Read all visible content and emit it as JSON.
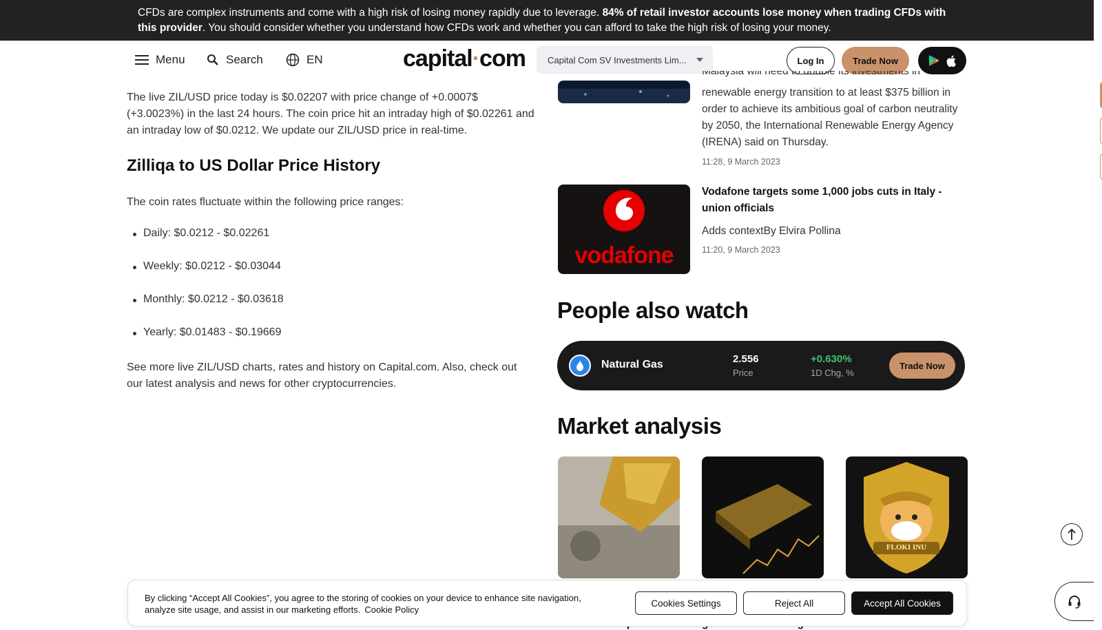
{
  "risk_banner": {
    "text_plain": "CFDs are complex instruments and come with a high risk of losing money rapidly due to leverage. ",
    "text_bold": "84% of retail investor accounts lose money when trading CFDs with this provider",
    "text_rest": ". You should consider whether you understand how CFDs work and whether you can afford to take the high risk of losing your money."
  },
  "header": {
    "menu_label": "Menu",
    "search_label": "Search",
    "language_label": "EN",
    "logo_left": "capital",
    "logo_dot": "·",
    "logo_right": "com",
    "entity_select_value": "Capital Com SV Investments Lim...",
    "login_label": "Log In",
    "trade_now_label": "Trade Now"
  },
  "main": {
    "intro": "The live ZIL/USD price today is $0.02207 with price change of +0.0007$ (+3.0023%) in the last 24 hours. The coin price hit an intraday high of $0.02261 and an intraday low of $0.0212. We update our ZIL/USD price in real-time.",
    "history_title": "Zilliqa to US Dollar Price History",
    "history_lead": "The coin rates fluctuate within the following price ranges:",
    "ranges": [
      "Daily: $0.0212 - $0.02261",
      "Weekly: $0.0212 - $0.03044",
      "Monthly: $0.0212 - $0.03618",
      "Yearly: $0.01483 - $0.19669"
    ],
    "outro": "See more live ZIL/USD charts, rates and history on Capital.com. Also, check out our latest analysis and news for other cryptocurrencies."
  },
  "news": [
    {
      "title_partial": "Malaysia will need to double its investments in",
      "text": "renewable energy transition to at least $375 billion in order to achieve its ambitious goal of carbon neutrality by 2050, the International Renewable Energy Agency (IRENA) said on Thursday.",
      "time": "11:28, 9 March 2023"
    },
    {
      "title": "Vodafone targets some 1,000 jobs cuts in Italy - union officials",
      "text": "Adds contextBy Elvira Pollina",
      "time": "11:20, 9 March 2023",
      "image_text": "vodafone"
    }
  ],
  "people_also_watch": {
    "title": "People also watch",
    "name": "Natural Gas",
    "price": "2.556",
    "price_label": "Price",
    "change": "+0.630%",
    "change_label": "1D Chg, %",
    "trade_label": "Trade Now"
  },
  "market_analysis": {
    "title": "Market analysis",
    "captions": [
      "the dollar keep it",
      "gold continue rising",
      "for FLOKI?"
    ],
    "floki_badge_text": "FLOKI INU"
  },
  "cookie": {
    "text": "By clicking “Accept All Cookies”, you agree to the storing of cookies on your device to enhance site navigation, analyze site usage, and assist in our marketing efforts.",
    "policy_link": "Cookie Policy",
    "settings_label": "Cookies Settings",
    "reject_label": "Reject All",
    "accept_label": "Accept All Cookies"
  },
  "colors": {
    "accent": "#c9926a",
    "positive": "#3ec46d",
    "banner_bg": "#222222",
    "dark_card": "#1a1a1a"
  },
  "icons": [
    "hamburger-icon",
    "search-icon",
    "globe-icon",
    "chevron-down-icon",
    "google-play-icon",
    "apple-icon",
    "flame-icon",
    "arrow-up-icon",
    "headset-icon"
  ]
}
